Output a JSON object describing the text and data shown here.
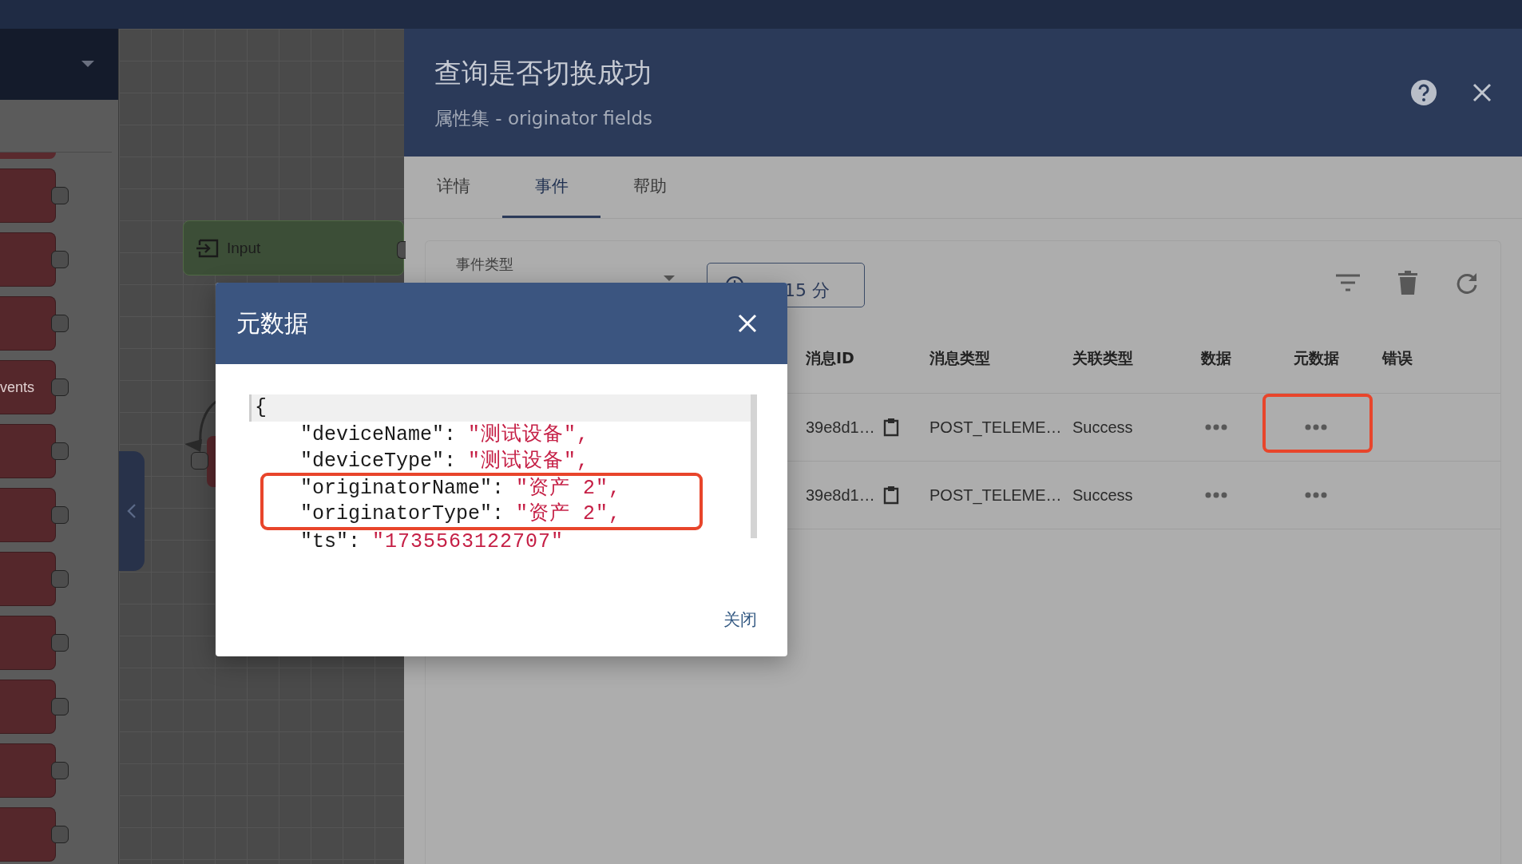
{
  "node_library": {
    "label": "vents"
  },
  "canvas": {
    "input_node": {
      "label": "Input"
    }
  },
  "drawer": {
    "title": "查询是否切换成功",
    "subtitle": "属性集 - originator fields",
    "tabs": [
      {
        "label": "详情",
        "selected": false
      },
      {
        "label": "事件",
        "selected": true
      },
      {
        "label": "帮助",
        "selected": false
      }
    ],
    "event_type": {
      "label": "事件类型"
    },
    "time_button": "15 分",
    "table": {
      "columns": [
        "消息ID",
        "消息类型",
        "关联类型",
        "数据",
        "元数据",
        "错误"
      ],
      "rows": [
        {
          "message_id": "39e8d1…",
          "message_type": "POST_TELEME…",
          "relation_type": "Success",
          "metadata_highlighted": true
        },
        {
          "message_id": "39e8d1…",
          "message_type": "POST_TELEME…",
          "relation_type": "Success",
          "metadata_highlighted": false
        }
      ]
    }
  },
  "dialog": {
    "title": "元数据",
    "open_line": "{",
    "lines": [
      {
        "key": "\"deviceName\":",
        "value": "\"测试设备\",",
        "highlighted": false
      },
      {
        "key": "\"deviceType\":",
        "value": "\"测试设备\",",
        "highlighted": false
      },
      {
        "key": "\"originatorName\":",
        "value": "\"资产 2\",",
        "highlighted": true
      },
      {
        "key": "\"originatorType\":",
        "value": "\"资产 2\",",
        "highlighted": true
      },
      {
        "key": "\"ts\":",
        "value": "\"1735563122707\"",
        "highlighted": false
      }
    ],
    "close_button": "关闭"
  }
}
